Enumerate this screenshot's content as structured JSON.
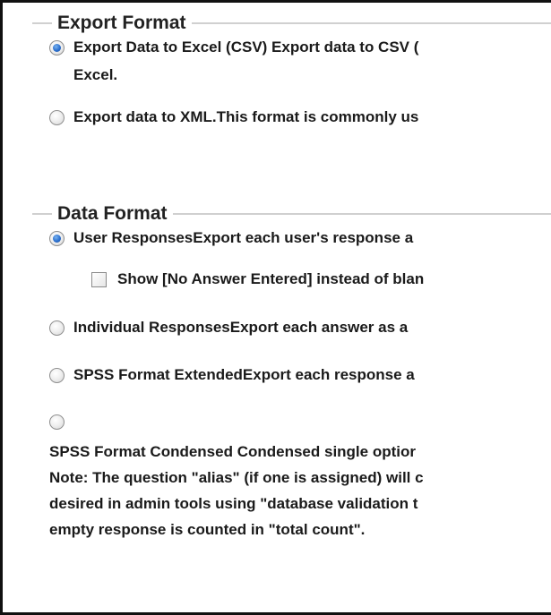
{
  "export_format": {
    "title": "Export Format",
    "options": [
      {
        "line1": "Export Data to Excel (CSV) Export data to CSV (",
        "line2": "Excel.",
        "selected": true
      },
      {
        "line1": "Export data to XML.This format is commonly us",
        "selected": false
      }
    ]
  },
  "data_format": {
    "title": "Data Format",
    "options": [
      {
        "label": "User ResponsesExport each user's response a",
        "selected": true
      },
      {
        "label": "Individual ResponsesExport each answer as a",
        "selected": false
      },
      {
        "label": "SPSS Format ExtendedExport each response a",
        "selected": false
      },
      {
        "label": "",
        "selected": false
      }
    ],
    "show_no_answer": {
      "label": "Show [No Answer Entered] instead of blan",
      "checked": false
    },
    "spss_condensed_lines": [
      "SPSS Format Condensed  Condensed single optior",
      "Note: The question \"alias\" (if one is assigned) will c",
      "desired in admin tools using \"database validation t",
      "empty response is counted in \"total count\"."
    ]
  },
  "colors": {
    "radio_selected": "#2a6fce",
    "text": "#1a1a1a",
    "divider": "#d0d0d0",
    "frame_border": "#111111"
  }
}
